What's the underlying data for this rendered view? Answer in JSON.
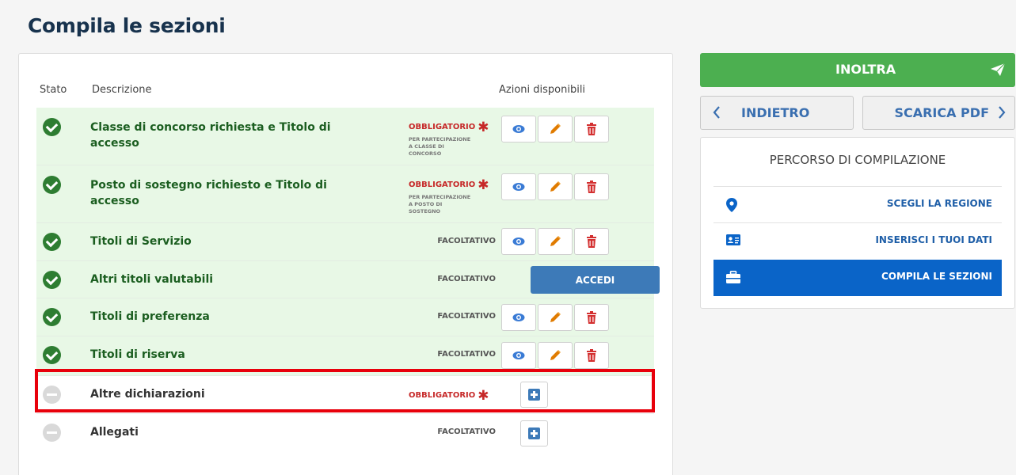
{
  "page_title": "Compila le sezioni",
  "table": {
    "headers": {
      "stato": "Stato",
      "descrizione": "Descrizione",
      "azioni": "Azioni disponibili"
    },
    "rows": [
      {
        "status": "complete",
        "label": "Classe di concorso richiesta e Titolo di accesso",
        "badge": "OBBLIGATORIO",
        "badge_sub": [
          "PER PARTECIPAZIONE",
          "A CLASSE DI",
          "CONCORSO"
        ],
        "actions": [
          "view",
          "edit",
          "delete"
        ]
      },
      {
        "status": "complete",
        "label": "Posto di sostegno richiesto e Titolo di accesso",
        "badge": "OBBLIGATORIO",
        "badge_sub": [
          "PER PARTECIPAZIONE",
          "A POSTO DI",
          "SOSTEGNO"
        ],
        "actions": [
          "view",
          "edit",
          "delete"
        ]
      },
      {
        "status": "complete",
        "label": "Titoli di Servizio",
        "badge": "FACOLTATIVO",
        "actions": [
          "view",
          "edit",
          "delete"
        ]
      },
      {
        "status": "complete",
        "label": "Altri titoli valutabili",
        "badge": "FACOLTATIVO",
        "actions": [
          "accedi"
        ]
      },
      {
        "status": "complete",
        "label": "Titoli di preferenza",
        "badge": "FACOLTATIVO",
        "actions": [
          "view",
          "edit",
          "delete"
        ]
      },
      {
        "status": "complete",
        "label": "Titoli di riserva",
        "badge": "FACOLTATIVO",
        "actions": [
          "view",
          "edit",
          "delete"
        ]
      },
      {
        "status": "incomplete",
        "label": "Altre dichiarazioni",
        "badge": "OBBLIGATORIO",
        "actions": [
          "add"
        ],
        "highlighted": true
      },
      {
        "status": "incomplete",
        "label": "Allegati",
        "badge": "FACOLTATIVO",
        "actions": [
          "add"
        ]
      }
    ],
    "accedi_label": "ACCEDI"
  },
  "sidebar": {
    "inoltra_label": "INOLTRA",
    "indietro_label": "INDIETRO",
    "scarica_pdf_label": "SCARICA PDF",
    "percorso_title": "PERCORSO DI COMPILAZIONE",
    "steps": [
      {
        "label": "SCEGLI LA REGIONE",
        "icon": "map-marker-icon",
        "active": false
      },
      {
        "label": "INSERISCI I TUOI DATI",
        "icon": "id-card-icon",
        "active": false
      },
      {
        "label": "COMPILA LE SEZIONI",
        "icon": "briefcase-icon",
        "active": true
      }
    ]
  },
  "colors": {
    "success": "#2e7d32",
    "success_bg": "#e8f8e6",
    "required": "#c62828",
    "primary": "#0a64c8",
    "inoltra": "#4caf50",
    "highlight": "#e8000b"
  }
}
